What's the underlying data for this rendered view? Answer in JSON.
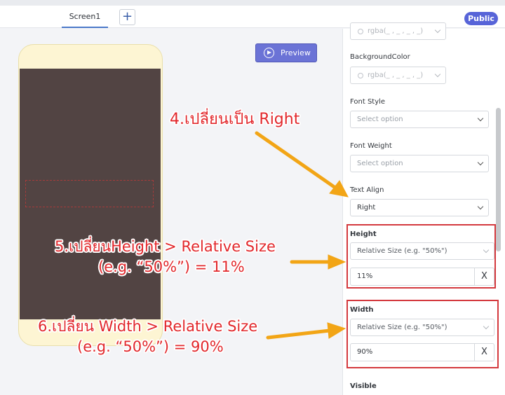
{
  "topbar": {
    "tab_label": "Screen1",
    "add_tab_label": "+",
    "public_label": "Public"
  },
  "canvas": {
    "preview_label": "Preview"
  },
  "panel": {
    "color_value": "rgba(_ , _ , _ , _)",
    "background_color_label": "BackgroundColor",
    "background_color_value": "rgba(_ , _ , _ , _)",
    "font_style_label": "Font Style",
    "font_style_placeholder": "Select option",
    "font_weight_label": "Font Weight",
    "font_weight_placeholder": "Select option",
    "text_align_label": "Text Align",
    "text_align_value": "Right",
    "height_label": "Height",
    "height_mode": "Relative Size (e.g. \"50%\")",
    "height_value": "11%",
    "width_label": "Width",
    "width_mode": "Relative Size (e.g. \"50%\")",
    "width_value": "90%",
    "visible_label": "Visible",
    "clear_glyph": "X"
  },
  "annotations": {
    "step4": "4.เปลี่ยนเป็น Right",
    "step5_line1": "5.เปลี่ยนHeight > Relative Size",
    "step5_line2": "(e.g. “50%”) = 11%",
    "step6_line1": "6.เปลี่ยน Width > Relative Size",
    "step6_line2": "(e.g. “50%”) = 90%"
  },
  "colors": {
    "accent": "#5764d8",
    "preview_button": "#6b73d6",
    "phone_frame": "#fdf5d3",
    "phone_screen": "#524443",
    "annotation_red": "#e2282c",
    "arrow_orange": "#f2a516"
  }
}
